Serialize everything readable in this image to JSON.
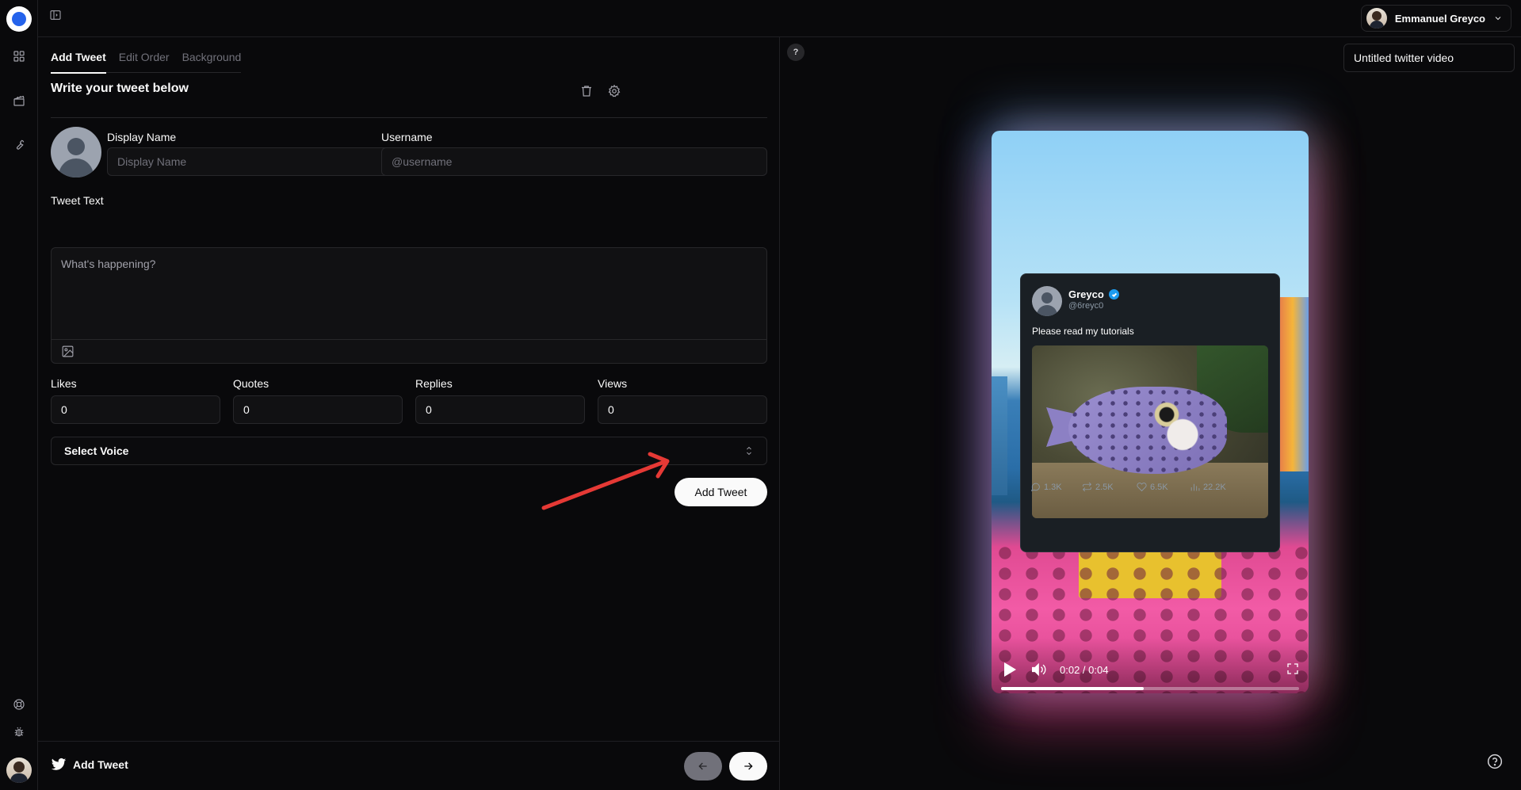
{
  "topbar": {
    "user_name": "Emmanuel Greyco"
  },
  "editor": {
    "tabs": [
      {
        "label": "Add Tweet",
        "active": true
      },
      {
        "label": "Edit Order",
        "active": false
      },
      {
        "label": "Background",
        "active": false
      }
    ],
    "section_title": "Write your tweet below",
    "display_name": {
      "label": "Display Name",
      "value": "",
      "placeholder": "Display Name"
    },
    "username": {
      "label": "Username",
      "value": "",
      "placeholder": "@username"
    },
    "tweet_text": {
      "label": "Tweet Text",
      "value": "",
      "placeholder": "What's happening?"
    },
    "metrics": [
      {
        "label": "Likes",
        "value": "0"
      },
      {
        "label": "Quotes",
        "value": "0"
      },
      {
        "label": "Replies",
        "value": "0"
      },
      {
        "label": "Views",
        "value": "0"
      }
    ],
    "voice_select": {
      "value": "Select Voice"
    },
    "add_button_label": "Add Tweet",
    "footer_title": "Add Tweet"
  },
  "preview": {
    "help_label": "?",
    "video_title": "Untitled twitter video",
    "tweet": {
      "name": "Greyco",
      "handle": "@6reyc0",
      "text": "Please read my tutorials",
      "replies": "1.3K",
      "retweets": "2.5K",
      "likes": "6.5K",
      "views": "22.2K"
    },
    "player": {
      "time": "0:02 / 0:04",
      "progress": 0.48
    }
  },
  "colors": {
    "background": "#09090b",
    "border": "#27272a",
    "annotation_arrow": "#e53935",
    "verified": "#1d9bf0"
  }
}
